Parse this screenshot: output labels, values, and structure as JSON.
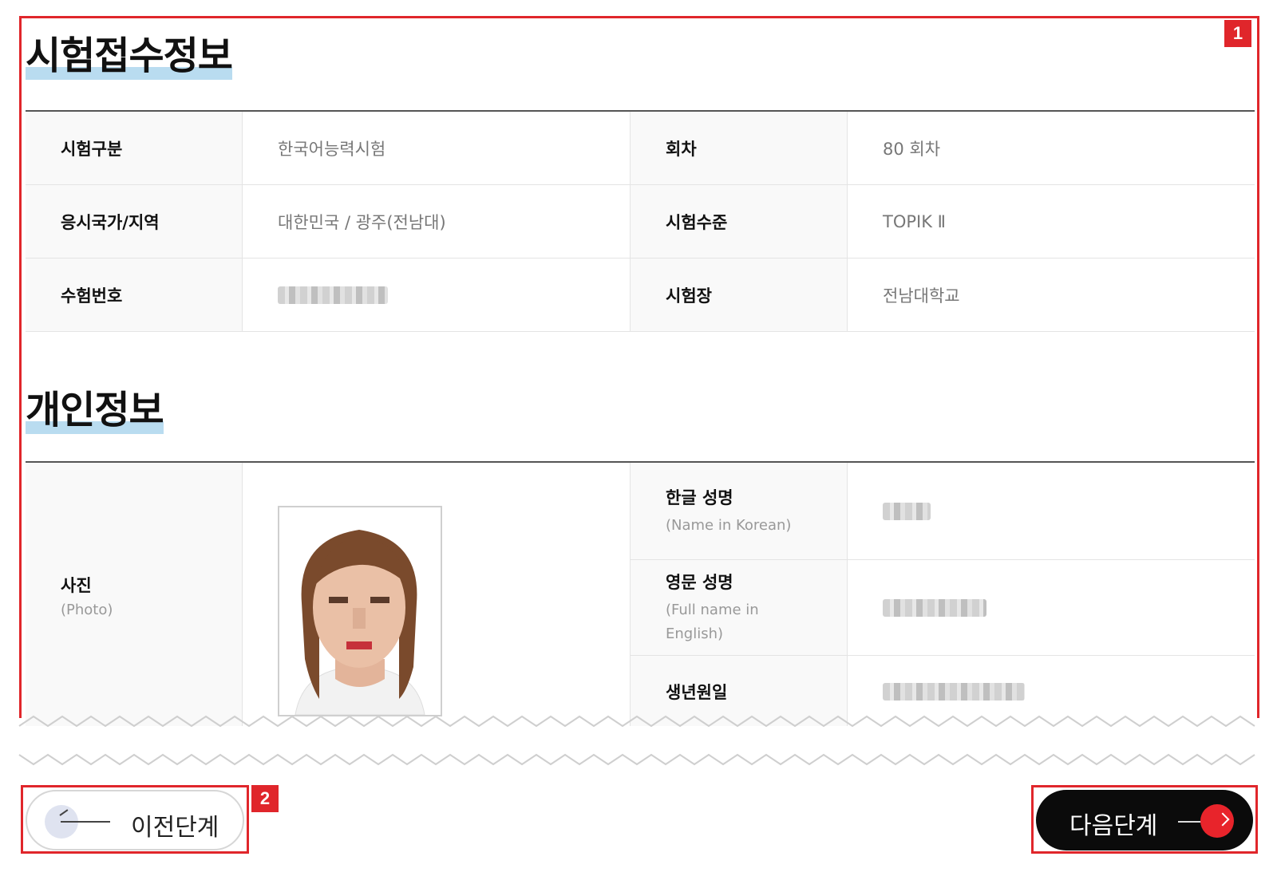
{
  "annotations": {
    "badge_1": "1",
    "badge_2": "2"
  },
  "exam_section": {
    "title": "시험접수정보",
    "rows": [
      {
        "label_a": "시험구분",
        "value_a": "한국어능력시험",
        "label_b": "회차",
        "value_b": "80 회차"
      },
      {
        "label_a": "응시국가/지역",
        "value_a": "대한민국 / 광주(전남대)",
        "label_b": "시험수준",
        "value_b": "TOPIK Ⅱ"
      },
      {
        "label_a": "수험번호",
        "value_a": "",
        "label_b": "시험장",
        "value_b": "전남대학교"
      }
    ]
  },
  "personal_section": {
    "title": "개인정보",
    "photo_label": "사진",
    "photo_sub": "(Photo)",
    "korean_name_label": "한글 성명",
    "korean_name_sub": "(Name in Korean)",
    "english_name_label": "영문 성명",
    "english_name_sub": "(Full name in English)",
    "birth_label": "생년원일"
  },
  "buttons": {
    "prev_label": "이전단계",
    "next_label": "다음단계"
  },
  "colors": {
    "annotation_red": "#e0262b",
    "title_highlight": "#b9dcf0",
    "next_button": "#0b0b0b",
    "next_circle": "#e8242b"
  }
}
